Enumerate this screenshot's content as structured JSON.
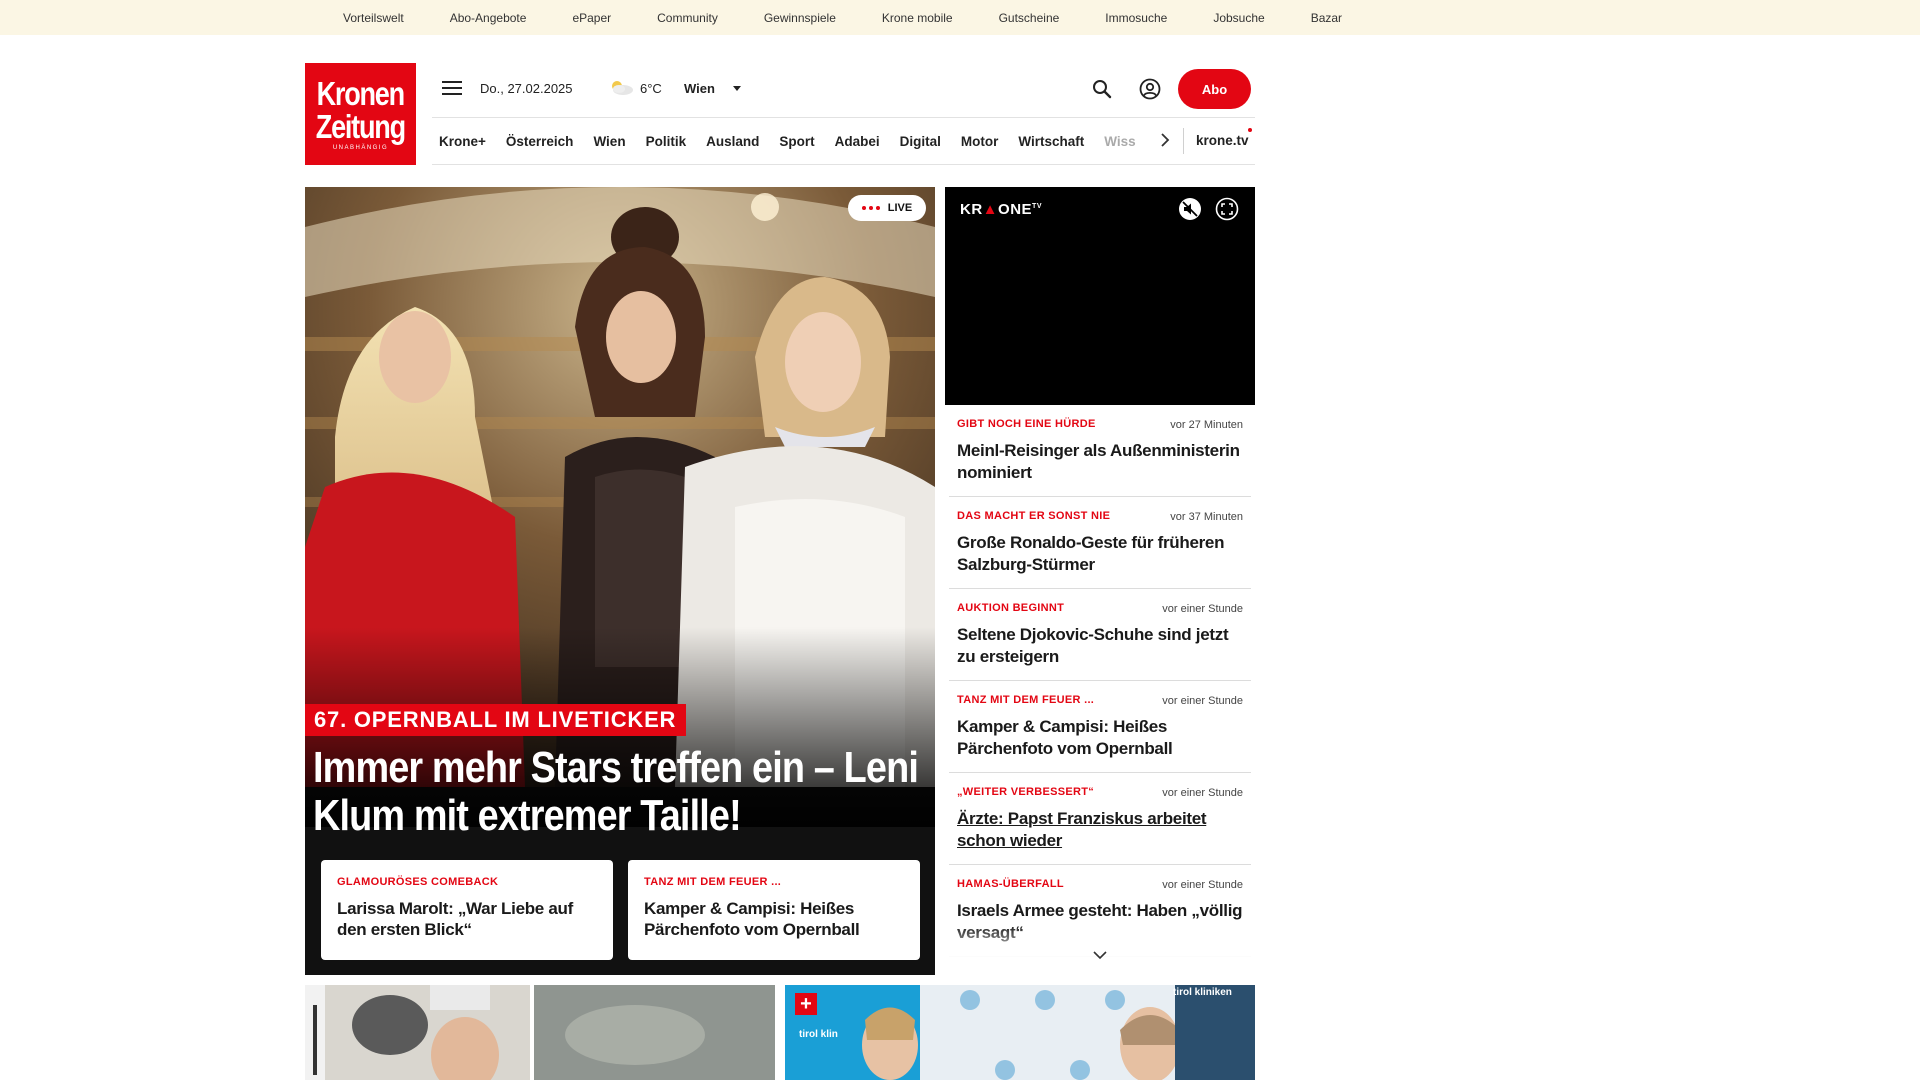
{
  "topbar": {
    "links": [
      "Vorteilswelt",
      "Abo-Angebote",
      "ePaper",
      "Community",
      "Gewinnspiele",
      "Krone mobile",
      "Gutscheine",
      "Immosuche",
      "Jobsuche",
      "Bazar"
    ]
  },
  "header": {
    "logo_line1": "Kronen",
    "logo_line2": "Zeitung",
    "logo_line3": "UNABHÄNGIG",
    "date": "Do., 27.02.2025",
    "temperature": "6°C",
    "city": "Wien",
    "abo_label": "Abo"
  },
  "nav": {
    "items": [
      "Krone+",
      "Österreich",
      "Wien",
      "Politik",
      "Ausland",
      "Sport",
      "Adabei",
      "Digital",
      "Motor",
      "Wirtschaft",
      "Wiss"
    ],
    "tv_label": "krone.tv"
  },
  "hero": {
    "live_label": "LIVE",
    "kicker": "67. OPERNBALL IM LIVETICKER",
    "title": "Immer mehr Stars treffen ein – Leni Klum mit extremer Taille!",
    "cards": [
      {
        "kicker": "GLAMOURÖSES COMEBACK",
        "title": "Larissa Marolt: „War Liebe auf den ersten Blick“"
      },
      {
        "kicker": "TANZ MIT DEM FEUER ...",
        "title": "Kamper & Campisi: Heißes Pärchenfoto vom Opernball"
      }
    ]
  },
  "video": {
    "logo_a": "KR",
    "logo_b": "▲",
    "logo_c": "ONE",
    "logo_tv": "TV"
  },
  "news": [
    {
      "kicker": "GIBT NOCH EINE HÜRDE",
      "time": "vor 27 Minuten",
      "title": "Meinl-Reisinger als Außenministerin nominiert"
    },
    {
      "kicker": "DAS MACHT ER SONST NIE",
      "time": "vor 37 Minuten",
      "title": "Große Ronaldo-Geste für früheren Salzburg-Stürmer"
    },
    {
      "kicker": "AUKTION BEGINNT",
      "time": "vor einer Stunde",
      "title": "Seltene Djokovic-Schuhe sind jetzt zu ersteigern"
    },
    {
      "kicker": "TANZ MIT DEM FEUER ...",
      "time": "vor einer Stunde",
      "title": "Kamper & Campisi: Heißes Pärchenfoto vom Opernball"
    },
    {
      "kicker": "„WEITER VERBESSERT“",
      "time": "vor einer Stunde",
      "title": "Ärzte: Papst Franziskus arbeitet schon wieder"
    },
    {
      "kicker": "HAMAS-ÜBERFALL",
      "time": "vor einer Stunde",
      "title": "Israels Armee gesteht: Haben „völlig versagt“"
    }
  ],
  "teasers": {
    "t2_plus": "+",
    "t2_brand_a": "tirol kliniken",
    "t2_brand_b": "tirol klin"
  },
  "colors": {
    "brand_red": "#e30613",
    "topbar_bg": "#fbf6e4"
  }
}
